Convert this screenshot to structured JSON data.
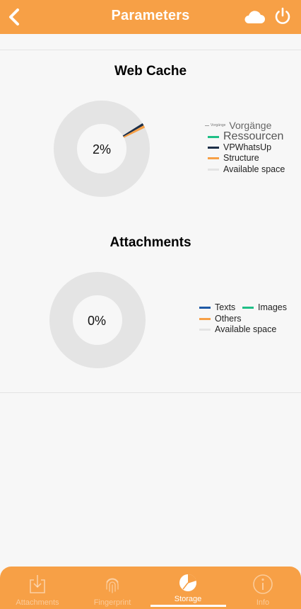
{
  "header": {
    "title": "Parameters"
  },
  "web_cache": {
    "title": "Web Cache",
    "percent": "2%",
    "legend": [
      {
        "label": "Vorgänge",
        "color": "#9e9e9e"
      },
      {
        "label": "Ressourcen",
        "color": "#1fbf86"
      },
      {
        "label": "VPWhatsUp",
        "color": "#1d2f48"
      },
      {
        "label": "Structure",
        "color": "#f7a046"
      },
      {
        "label": "Available space",
        "color": "#e4e4e4"
      }
    ]
  },
  "attachments": {
    "title": "Attachments",
    "percent": "0%",
    "legend": [
      {
        "label": "Texts",
        "color": "#1f5aa6"
      },
      {
        "label": "Images",
        "color": "#1fbf86"
      },
      {
        "label": "Others",
        "color": "#f7a046"
      },
      {
        "label": "Available space",
        "color": "#e4e4e4"
      }
    ]
  },
  "nav": {
    "items": [
      {
        "label": "Attachments"
      },
      {
        "label": "Fingerprint"
      },
      {
        "label": "Storage"
      },
      {
        "label": "Info"
      }
    ]
  },
  "colors": {
    "accent": "#f7a046",
    "donut_base": "#e4e4e4"
  }
}
